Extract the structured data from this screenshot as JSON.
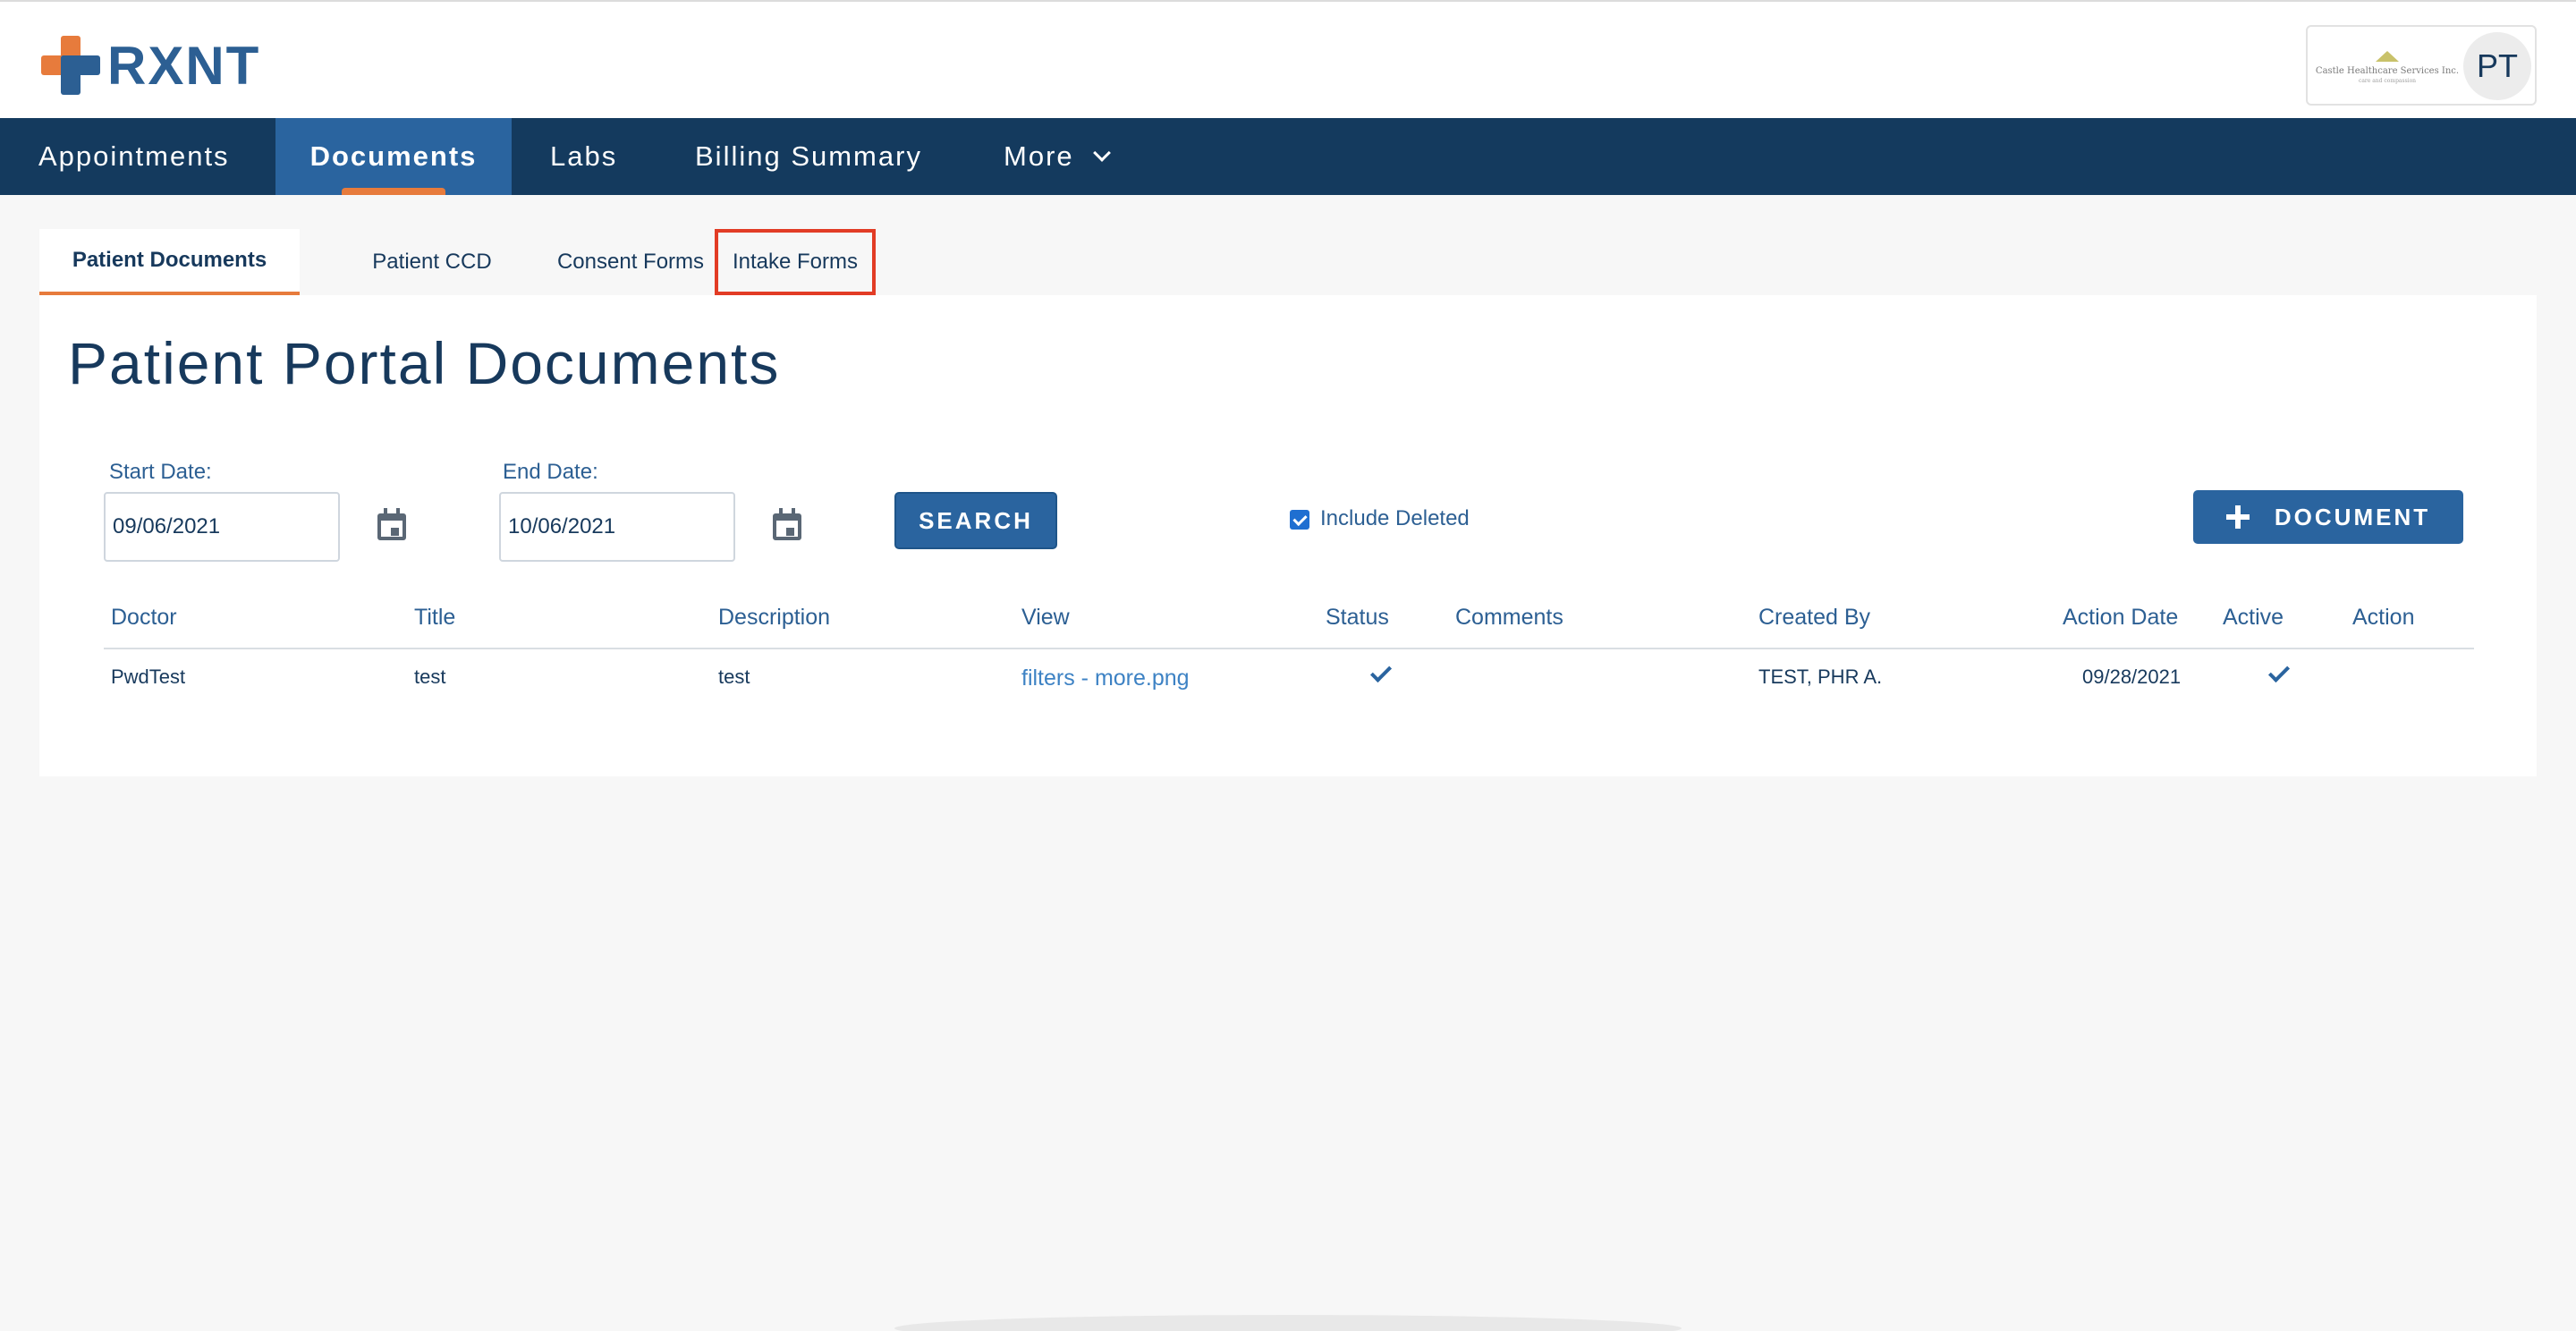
{
  "brand": {
    "logo_text": "RXNT"
  },
  "account": {
    "org_name": "Castle Healthcare Services Inc.",
    "org_tagline": "care and compassion",
    "avatar_initials": "PT"
  },
  "nav": {
    "items": [
      {
        "label": "Appointments"
      },
      {
        "label": "Documents",
        "active": true
      },
      {
        "label": "Labs"
      },
      {
        "label": "Billing Summary"
      },
      {
        "label": "More"
      }
    ]
  },
  "subtabs": [
    {
      "label": "Patient Documents",
      "active": true
    },
    {
      "label": "Patient CCD"
    },
    {
      "label": "Consent Forms"
    },
    {
      "label": "Intake Forms",
      "highlighted": true
    }
  ],
  "page": {
    "title": "Patient Portal Documents"
  },
  "filters": {
    "start_label": "Start Date:",
    "start_value": "09/06/2021",
    "end_label": "End Date:",
    "end_value": "10/06/2021",
    "search_label": "SEARCH",
    "include_deleted_label": "Include Deleted",
    "include_deleted_checked": true,
    "add_document_label": "DOCUMENT"
  },
  "table": {
    "columns": [
      "Doctor",
      "Title",
      "Description",
      "View",
      "Status",
      "Comments",
      "Created By",
      "Action Date",
      "Active",
      "Action"
    ],
    "rows": [
      {
        "doctor": "PwdTest",
        "title": "test",
        "description": "test",
        "view": "filters - more.png",
        "status": "checked",
        "comments": "",
        "created_by": "TEST, PHR A.",
        "action_date": "09/28/2021",
        "active": "checked",
        "action": ""
      }
    ]
  },
  "colors": {
    "nav_bg": "#143a5e",
    "nav_active_bg": "#2a649f",
    "accent_orange": "#e77b3c",
    "primary_blue": "#2a649f",
    "highlight_red": "#e23c25",
    "link_blue": "#3d82c4"
  }
}
